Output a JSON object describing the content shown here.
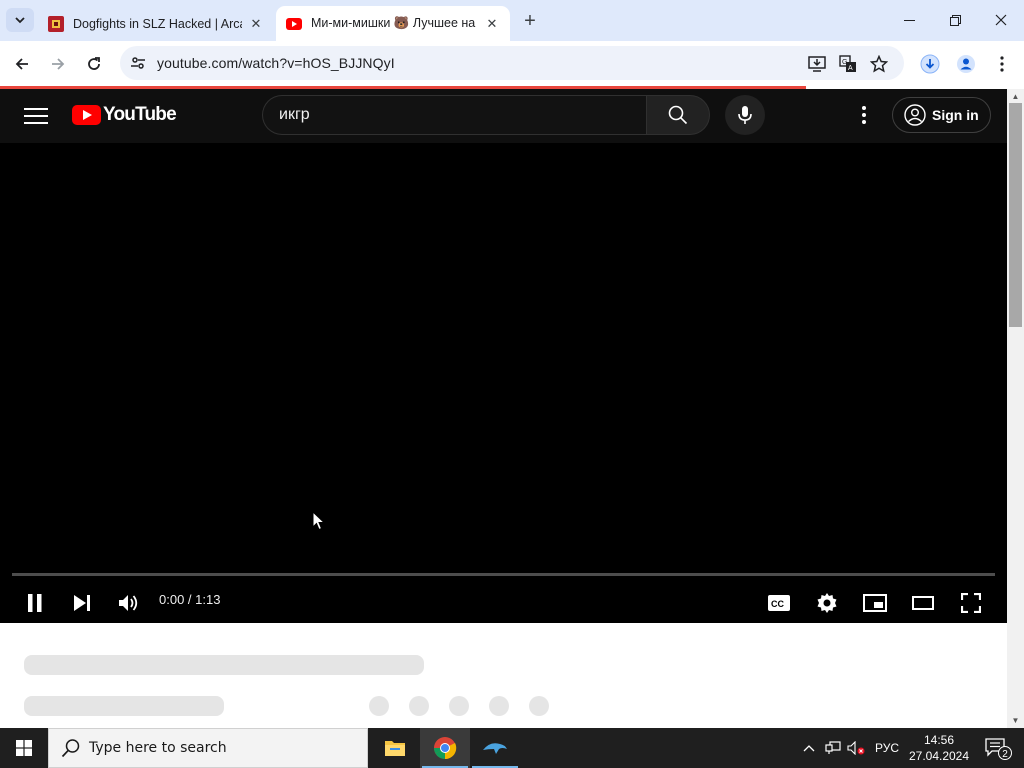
{
  "browser": {
    "tabs": [
      {
        "title": "Dogfights in SLZ Hacked | Arca",
        "favicon": "game-favicon",
        "active": false
      },
      {
        "title": "Ми-ми-мишки 🐻 Лучшее на",
        "favicon": "youtube-favicon",
        "active": true
      }
    ],
    "url": "youtube.com/watch?v=hOS_BJJNQyI"
  },
  "youtube": {
    "logo_text": "YouTube",
    "search_value": "икгр",
    "sign_in_label": "Sign in",
    "time_display": "0:00 / 1:13",
    "progress": 0,
    "brand_color": "#ff0000"
  },
  "taskbar": {
    "search_placeholder": "Type here to search",
    "language": "РУС",
    "time": "14:56",
    "date": "27.04.2024",
    "notification_count": "2",
    "apps": [
      "file-explorer",
      "chrome",
      "dolphin-emulator"
    ]
  }
}
